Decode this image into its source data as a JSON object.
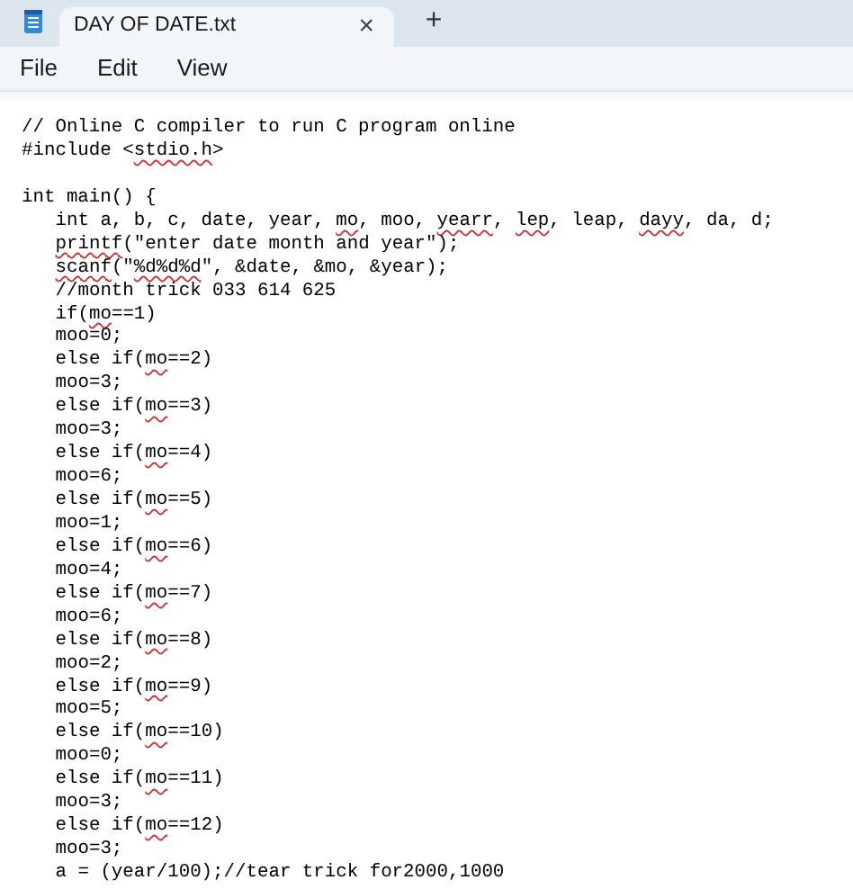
{
  "tabs": [
    {
      "title": "DAY OF DATE.txt",
      "selected": true,
      "close": "×"
    }
  ],
  "new_tab": "+",
  "menu": [
    "File",
    "Edit",
    "View"
  ],
  "lines": [
    {
      "kind": "code",
      "segments": [
        {
          "text": "// Online C compiler to run C program online",
          "misspelled": false
        }
      ]
    },
    {
      "kind": "code",
      "segments": [
        {
          "text": "#include <",
          "misspelled": false
        },
        {
          "text": "stdio.h",
          "misspelled": true
        },
        {
          "text": ">",
          "misspelled": false
        }
      ]
    },
    {
      "kind": "blank"
    },
    {
      "kind": "code",
      "segments": [
        {
          "text": "int main() {",
          "misspelled": false
        }
      ],
      "children": [
        {
          "kind": "code",
          "segments": [
            {
              "text": "int a, b, c, date, year, ",
              "misspelled": false
            },
            {
              "text": "mo",
              "misspelled": true
            },
            {
              "text": ", moo, ",
              "misspelled": false
            },
            {
              "text": "yearr",
              "misspelled": true
            },
            {
              "text": ", ",
              "misspelled": false
            },
            {
              "text": "lep",
              "misspelled": true
            },
            {
              "text": ", leap, ",
              "misspelled": false
            },
            {
              "text": "dayy",
              "misspelled": true
            },
            {
              "text": ", da, d;",
              "misspelled": false
            }
          ]
        },
        {
          "kind": "code",
          "segments": [
            {
              "text": "printf",
              "misspelled": true
            },
            {
              "text": "(\"enter date month and year\");",
              "misspelled": false
            }
          ]
        },
        {
          "kind": "code",
          "segments": [
            {
              "text": "scanf",
              "misspelled": true
            },
            {
              "text": "(\"",
              "misspelled": false
            },
            {
              "text": "%d%d%d",
              "misspelled": true
            },
            {
              "text": "\", &date, &mo, &year);",
              "misspelled": false
            }
          ]
        },
        {
          "kind": "code",
          "segments": [
            {
              "text": "//month trick 033 614 625",
              "misspelled": false
            }
          ]
        },
        {
          "kind": "code",
          "segments": [
            {
              "text": "if(",
              "misspelled": false
            },
            {
              "text": "mo",
              "misspelled": true
            },
            {
              "text": "==1)",
              "misspelled": false
            }
          ]
        },
        {
          "kind": "code",
          "segments": [
            {
              "text": "moo=0;",
              "misspelled": false
            }
          ]
        },
        {
          "kind": "code",
          "segments": [
            {
              "text": "else if(",
              "misspelled": false
            },
            {
              "text": "mo",
              "misspelled": true
            },
            {
              "text": "==2)",
              "misspelled": false
            }
          ]
        },
        {
          "kind": "code",
          "segments": [
            {
              "text": "moo=3;",
              "misspelled": false
            }
          ]
        },
        {
          "kind": "code",
          "segments": [
            {
              "text": "else if(",
              "misspelled": false
            },
            {
              "text": "mo",
              "misspelled": true
            },
            {
              "text": "==3)",
              "misspelled": false
            }
          ]
        },
        {
          "kind": "code",
          "segments": [
            {
              "text": "moo=3;",
              "misspelled": false
            }
          ]
        },
        {
          "kind": "code",
          "segments": [
            {
              "text": "else if(",
              "misspelled": false
            },
            {
              "text": "mo",
              "misspelled": true
            },
            {
              "text": "==4)",
              "misspelled": false
            }
          ]
        },
        {
          "kind": "code",
          "segments": [
            {
              "text": "moo=6;",
              "misspelled": false
            }
          ]
        },
        {
          "kind": "code",
          "segments": [
            {
              "text": "else if(",
              "misspelled": false
            },
            {
              "text": "mo",
              "misspelled": true
            },
            {
              "text": "==5)",
              "misspelled": false
            }
          ]
        },
        {
          "kind": "code",
          "segments": [
            {
              "text": "moo=1;",
              "misspelled": false
            }
          ]
        },
        {
          "kind": "code",
          "segments": [
            {
              "text": "else if(",
              "misspelled": false
            },
            {
              "text": "mo",
              "misspelled": true
            },
            {
              "text": "==6)",
              "misspelled": false
            }
          ]
        },
        {
          "kind": "code",
          "segments": [
            {
              "text": "moo=4;",
              "misspelled": false
            }
          ]
        },
        {
          "kind": "code",
          "segments": [
            {
              "text": "else if(",
              "misspelled": false
            },
            {
              "text": "mo",
              "misspelled": true
            },
            {
              "text": "==7)",
              "misspelled": false
            }
          ]
        },
        {
          "kind": "code",
          "segments": [
            {
              "text": "moo=6;",
              "misspelled": false
            }
          ]
        },
        {
          "kind": "code",
          "segments": [
            {
              "text": "else if(",
              "misspelled": false
            },
            {
              "text": "mo",
              "misspelled": true
            },
            {
              "text": "==8)",
              "misspelled": false
            }
          ]
        },
        {
          "kind": "code",
          "segments": [
            {
              "text": "moo=2;",
              "misspelled": false
            }
          ]
        },
        {
          "kind": "code",
          "segments": [
            {
              "text": "else if(",
              "misspelled": false
            },
            {
              "text": "mo",
              "misspelled": true
            },
            {
              "text": "==9)",
              "misspelled": false
            }
          ]
        },
        {
          "kind": "code",
          "segments": [
            {
              "text": "moo=5;",
              "misspelled": false
            }
          ]
        },
        {
          "kind": "code",
          "segments": [
            {
              "text": "else if(",
              "misspelled": false
            },
            {
              "text": "mo",
              "misspelled": true
            },
            {
              "text": "==10)",
              "misspelled": false
            }
          ]
        },
        {
          "kind": "code",
          "segments": [
            {
              "text": "moo=0;",
              "misspelled": false
            }
          ]
        },
        {
          "kind": "code",
          "segments": [
            {
              "text": "else if(",
              "misspelled": false
            },
            {
              "text": "mo",
              "misspelled": true
            },
            {
              "text": "==11)",
              "misspelled": false
            }
          ]
        },
        {
          "kind": "code",
          "segments": [
            {
              "text": "moo=3;",
              "misspelled": false
            }
          ]
        },
        {
          "kind": "code",
          "segments": [
            {
              "text": "else if(",
              "misspelled": false
            },
            {
              "text": "mo",
              "misspelled": true
            },
            {
              "text": "==12)",
              "misspelled": false
            }
          ]
        },
        {
          "kind": "code",
          "segments": [
            {
              "text": "moo=3;",
              "misspelled": false
            }
          ]
        },
        {
          "kind": "code",
          "segments": [
            {
              "text": "a = (year/100);//tear trick for2000,1000",
              "misspelled": false
            }
          ]
        }
      ]
    }
  ]
}
